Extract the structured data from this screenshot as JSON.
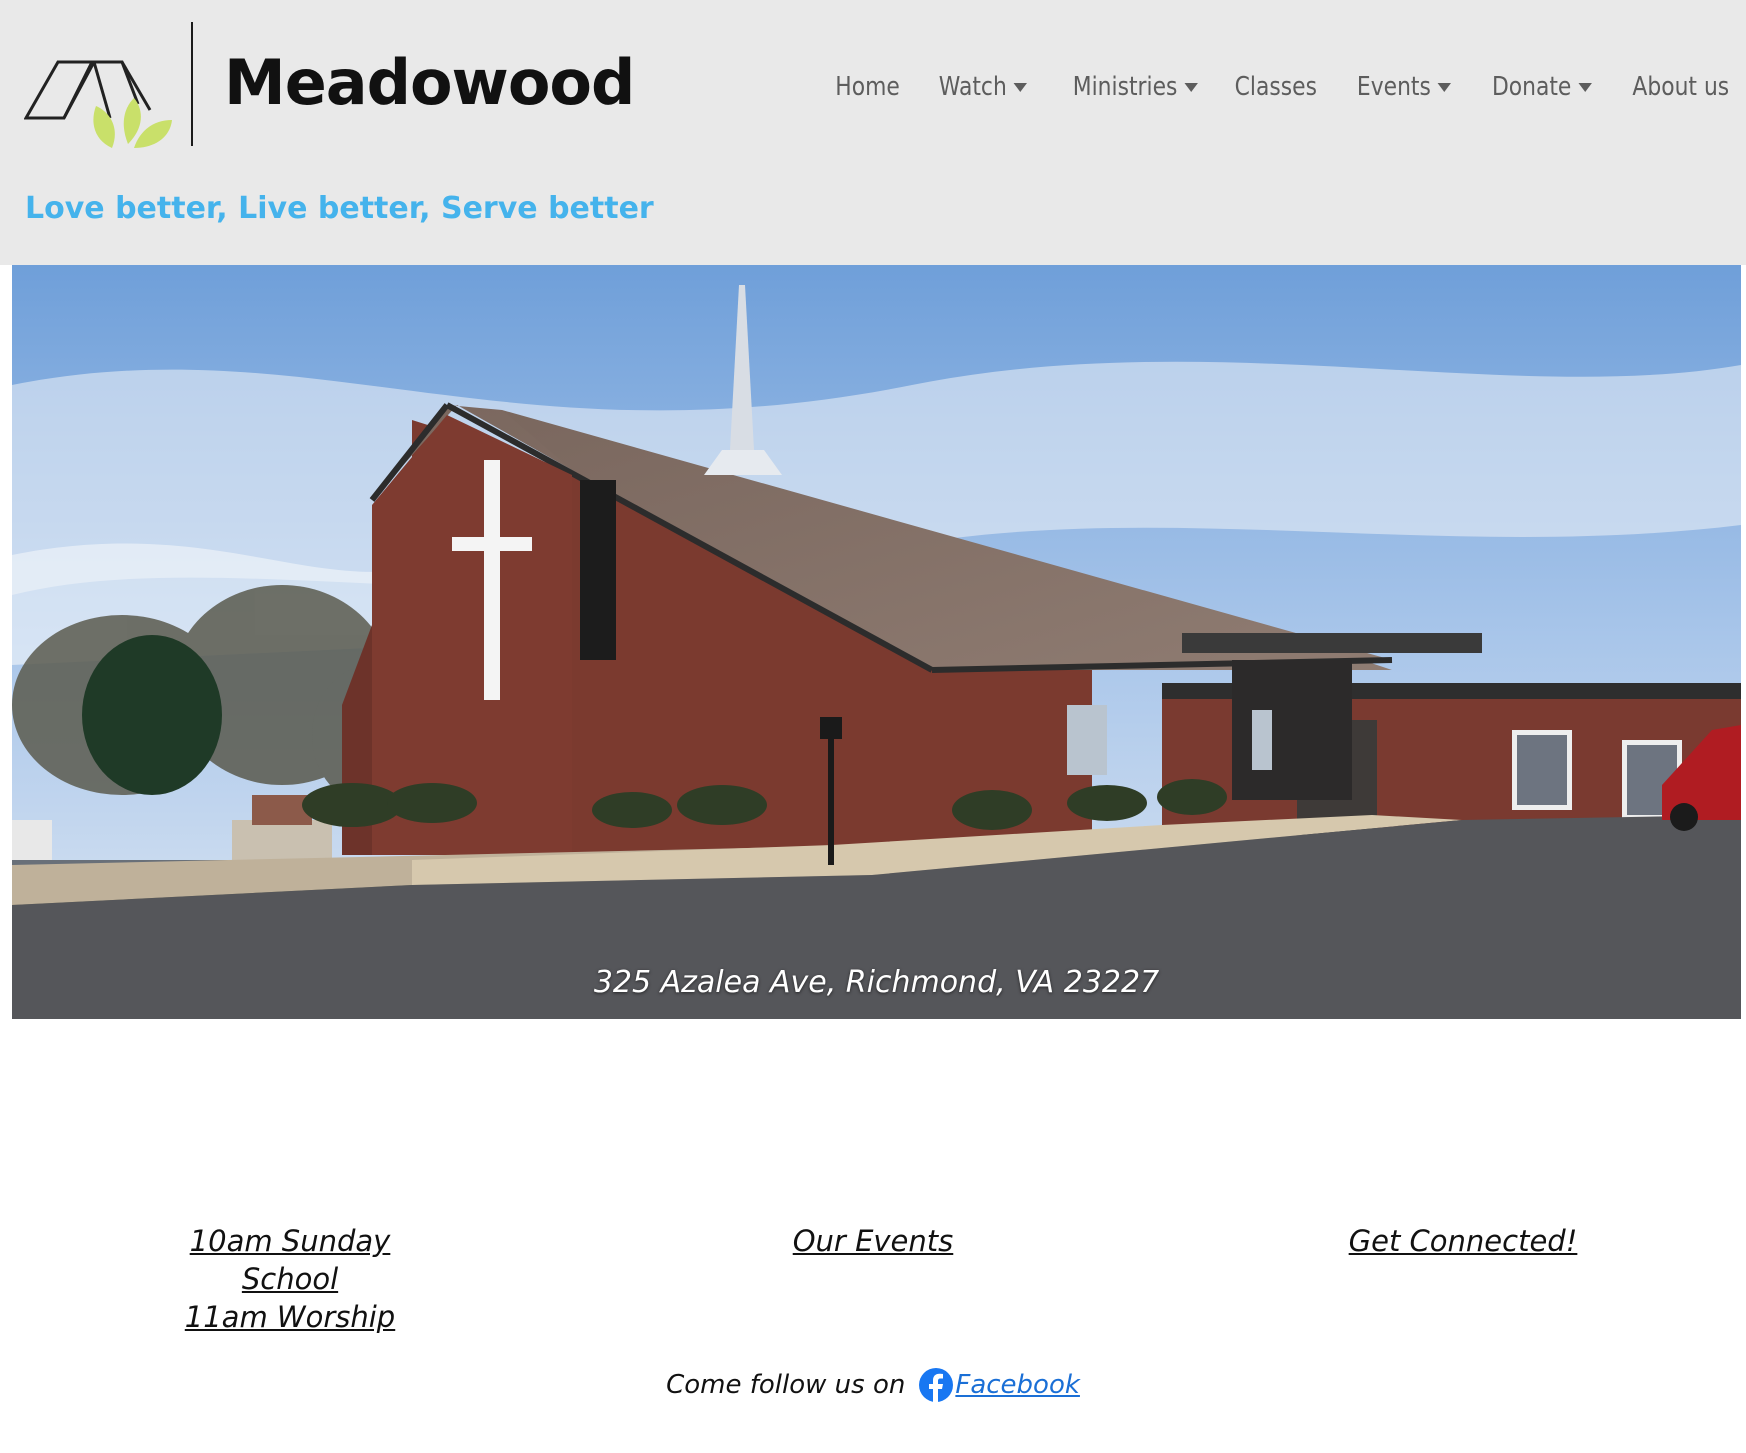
{
  "brand": {
    "name": "Meadowood",
    "tagline": "Love better, Live better, Serve better",
    "colors": {
      "tagline": "#45b3ec",
      "leaf": "#c9e06a",
      "header_bg": "#e9e9e9"
    }
  },
  "nav": {
    "items": [
      {
        "label": "Home",
        "dropdown": false
      },
      {
        "label": "Watch",
        "dropdown": true
      },
      {
        "label": "Ministries",
        "dropdown": true
      },
      {
        "label": "Classes",
        "dropdown": false
      },
      {
        "label": "Events",
        "dropdown": true
      },
      {
        "label": "Donate",
        "dropdown": true
      },
      {
        "label": "About us",
        "dropdown": false
      }
    ]
  },
  "hero": {
    "caption": "325 Azalea Ave, Richmond, VA 23227"
  },
  "links": {
    "schedule_line1": "10am Sunday School",
    "schedule_line2": "11am Worship",
    "events": "Our Events",
    "connect": "Get Connected!"
  },
  "follow": {
    "text": "Come follow us on",
    "link_label": "Facebook",
    "icon": "facebook-icon"
  }
}
